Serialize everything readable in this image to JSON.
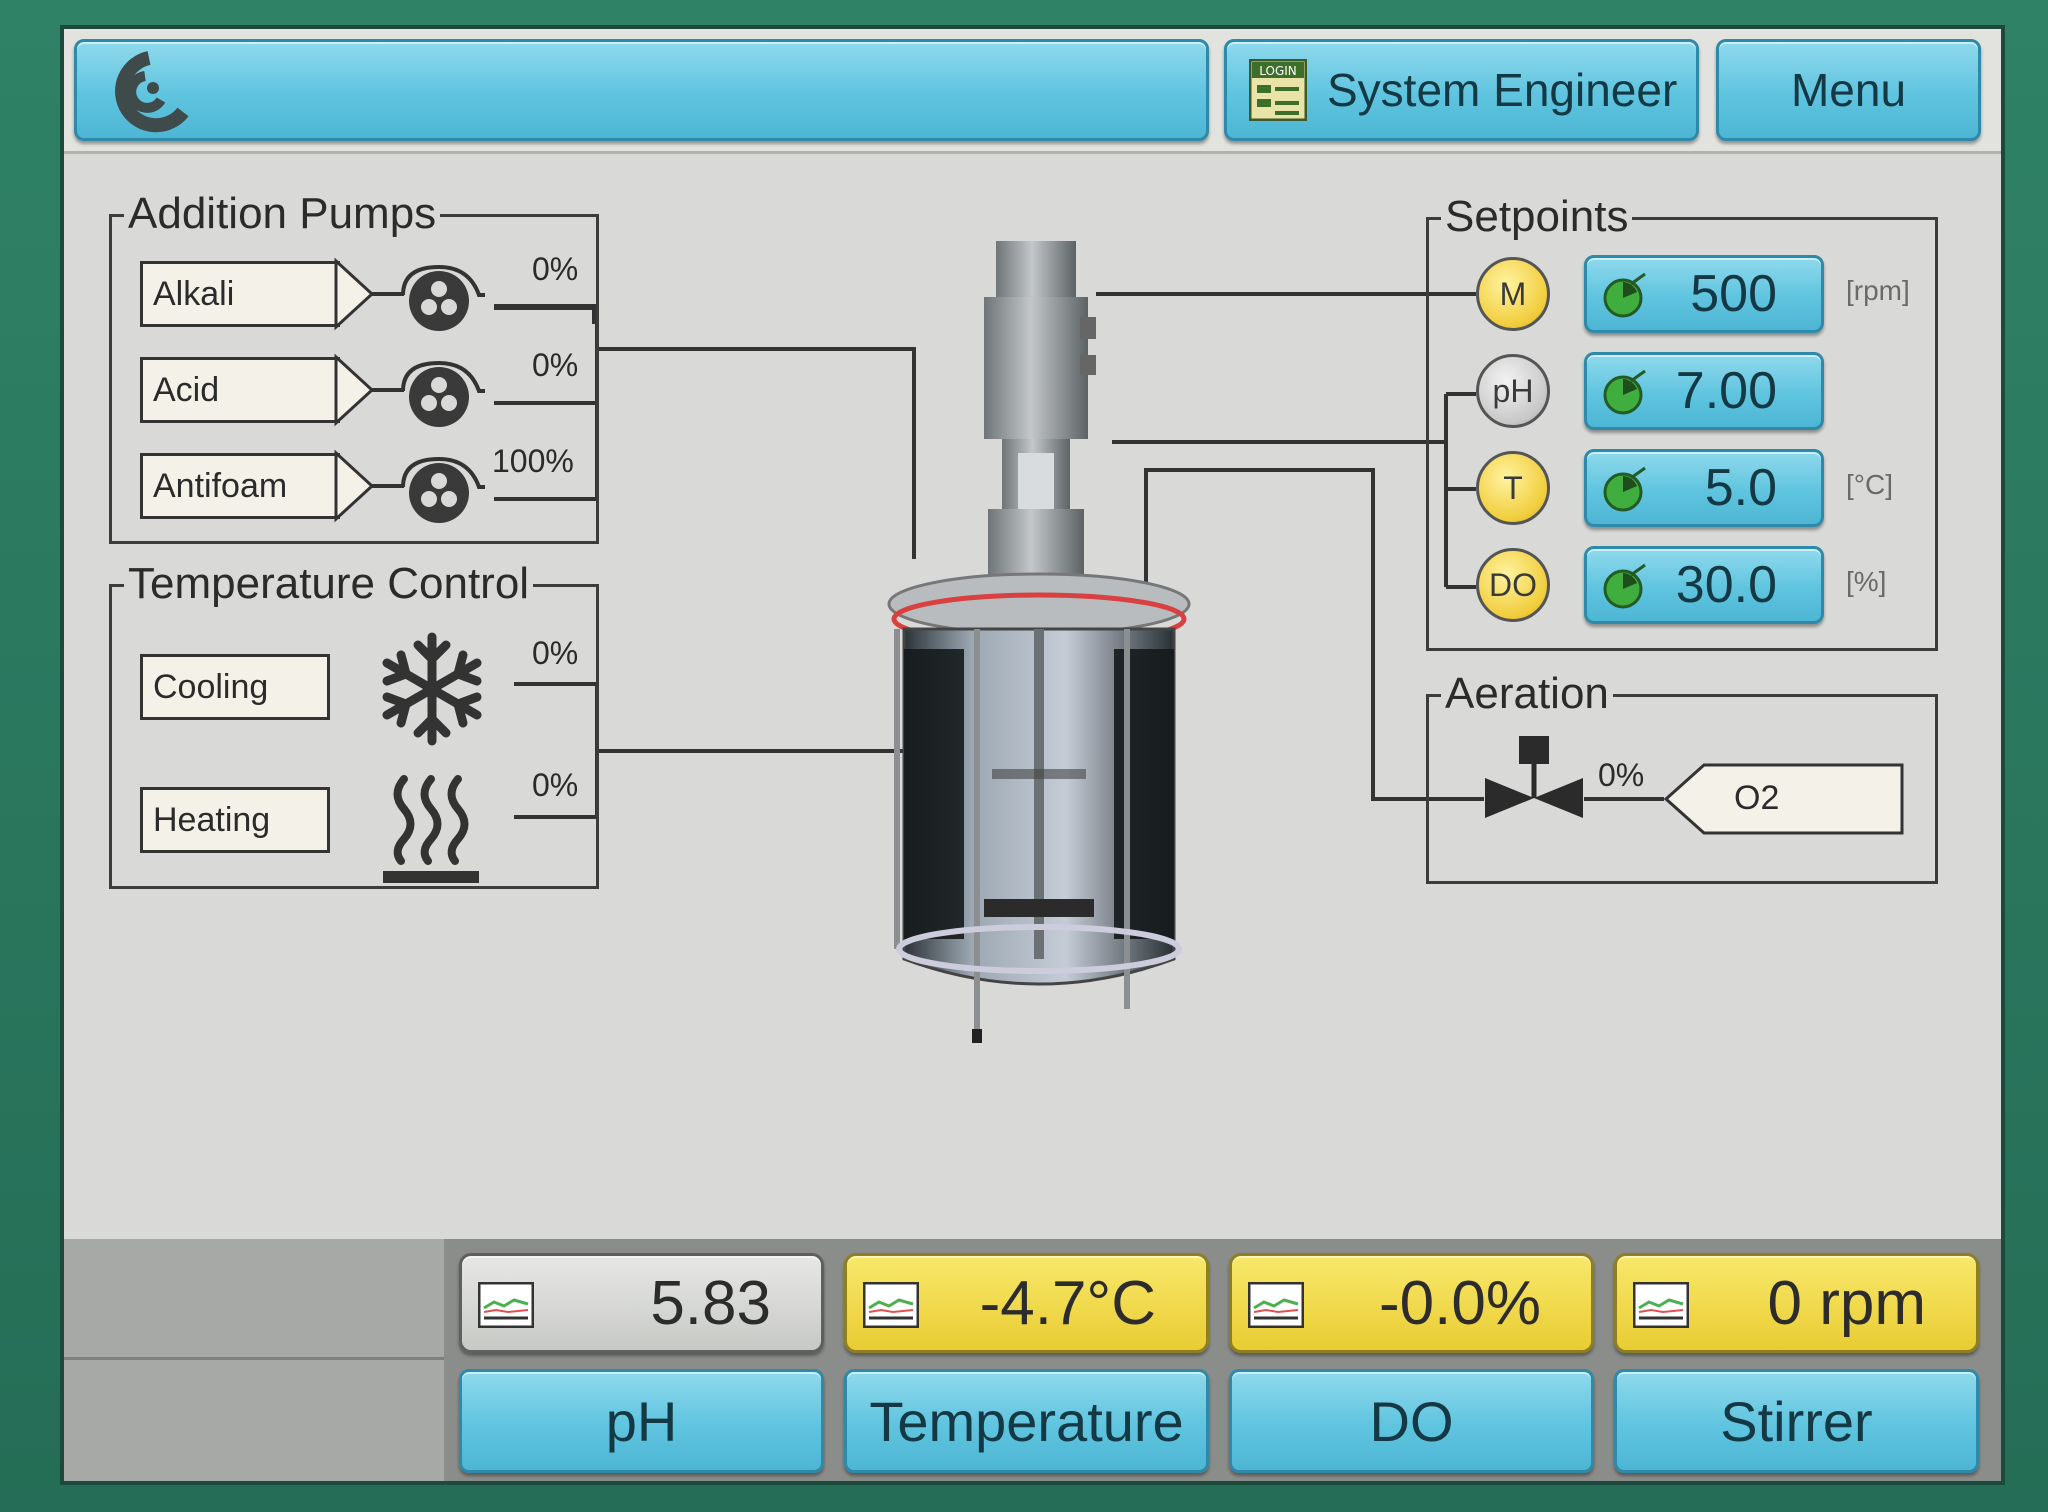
{
  "header": {
    "user_label": "System Engineer",
    "login_icon_text": "LOGIN",
    "menu_label": "Menu"
  },
  "addition_pumps": {
    "title": "Addition Pumps",
    "pumps": [
      {
        "label": "Alkali",
        "percent": "0%"
      },
      {
        "label": "Acid",
        "percent": "0%"
      },
      {
        "label": "Antifoam",
        "percent": "100%"
      }
    ]
  },
  "temperature_control": {
    "title": "Temperature Control",
    "cooling": {
      "label": "Cooling",
      "percent": "0%"
    },
    "heating": {
      "label": "Heating",
      "percent": "0%"
    }
  },
  "setpoints": {
    "title": "Setpoints",
    "items": [
      {
        "symbol": "M",
        "value": "500",
        "unit": "[rpm]",
        "color": "#f1cd3b"
      },
      {
        "symbol": "pH",
        "value": "7.00",
        "unit": "",
        "color": "#c8c8c8"
      },
      {
        "symbol": "T",
        "value": "5.0",
        "unit": "[°C]",
        "color": "#f1cd3b"
      },
      {
        "symbol": "DO",
        "value": "30.0",
        "unit": "[%]",
        "color": "#f1cd3b"
      }
    ]
  },
  "aeration": {
    "title": "Aeration",
    "percent": "0%",
    "gas": "O2"
  },
  "readouts": [
    {
      "value": "5.83",
      "style": "grey"
    },
    {
      "value": "-4.7°C",
      "style": "yellow"
    },
    {
      "value": "-0.0%",
      "style": "yellow"
    },
    {
      "value": "0 rpm",
      "style": "yellow"
    }
  ],
  "nav": [
    "pH",
    "Temperature",
    "DO",
    "Stirrer"
  ],
  "colors": {
    "accent_cyan": "#5fc4df",
    "readout_yellow": "#e9cc33",
    "bezel_green": "#2d7a62"
  }
}
